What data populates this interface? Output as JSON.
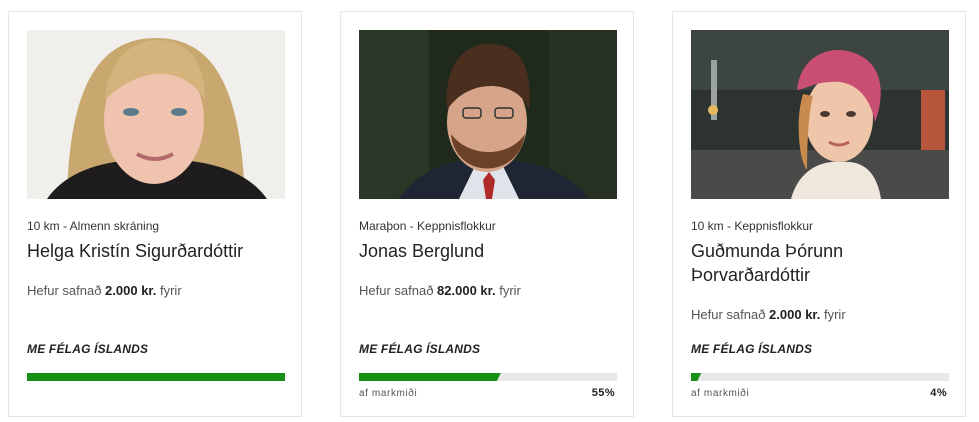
{
  "cards": [
    {
      "category": "10 km - Almenn skráning",
      "name": "Helga Kristín Sigurðardóttir",
      "raised_prefix": "Hefur safnað ",
      "raised_amount": "2.000 kr.",
      "raised_suffix": " fyrir",
      "organization": "ME FÉLAG ÍSLANDS",
      "progress_fraction": 1.0,
      "goal_label": "",
      "goal_percent": ""
    },
    {
      "category": "Maraþon - Keppnisflokkur",
      "name": "Jonas Berglund",
      "raised_prefix": "Hefur safnað ",
      "raised_amount": "82.000 kr.",
      "raised_suffix": " fyrir",
      "organization": "ME FÉLAG ÍSLANDS",
      "progress_fraction": 0.55,
      "goal_label": "af markmiði",
      "goal_percent": "55%"
    },
    {
      "category": "10 km - Keppnisflokkur",
      "name": "Guðmunda Þórunn Þorvarðardóttir",
      "raised_prefix": "Hefur safnað ",
      "raised_amount": "2.000 kr.",
      "raised_suffix": " fyrir",
      "organization": "ME FÉLAG ÍSLANDS",
      "progress_fraction": 0.04,
      "goal_label": "af markmiði",
      "goal_percent": "4%"
    }
  ],
  "colors": {
    "progress_fill": "#169116",
    "progress_track": "#e8e8e8",
    "card_border": "#e5e5e5"
  }
}
